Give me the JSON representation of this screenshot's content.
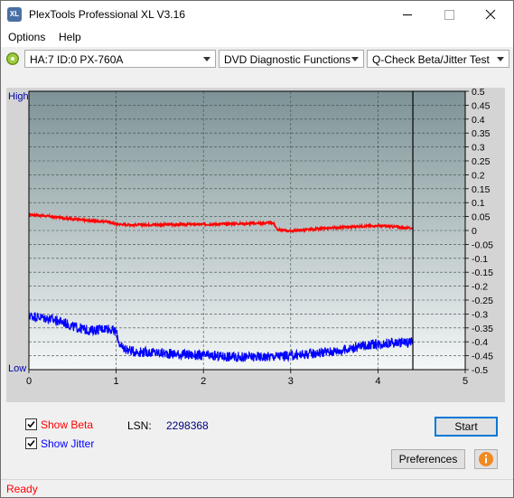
{
  "window": {
    "title": "PlexTools Professional XL V3.16",
    "icon_text": "XL"
  },
  "menu": {
    "options": "Options",
    "help": "Help"
  },
  "toolbar": {
    "drive": "HA:7 ID:0  PX-760A",
    "function": "DVD Diagnostic Functions",
    "test": "Q-Check Beta/Jitter Test"
  },
  "chart_data": {
    "type": "line",
    "left_axis_labels": {
      "high": "High",
      "low": "Low"
    },
    "x_ticks": [
      "0",
      "1",
      "2",
      "3",
      "4",
      "5"
    ],
    "y_ticks": [
      "0.5",
      "0.45",
      "0.4",
      "0.35",
      "0.3",
      "0.25",
      "0.2",
      "0.15",
      "0.1",
      "0.05",
      "0",
      "-0.05",
      "-0.1",
      "-0.15",
      "-0.2",
      "-0.25",
      "-0.3",
      "-0.35",
      "-0.4",
      "-0.45",
      "-0.5"
    ],
    "xlim": [
      0,
      5
    ],
    "ylim": [
      -0.5,
      0.5
    ],
    "grid": true,
    "end_marker_x": 4.4,
    "series": [
      {
        "color": "#ff0000",
        "x": [
          0,
          0.2,
          0.4,
          0.6,
          0.8,
          0.9,
          1.0,
          1.2,
          1.5,
          2.0,
          2.5,
          2.8,
          2.85,
          3.0,
          3.2,
          3.5,
          3.8,
          4.0,
          4.2,
          4.4
        ],
        "y": [
          0.058,
          0.052,
          0.045,
          0.038,
          0.033,
          0.032,
          0.023,
          0.02,
          0.021,
          0.022,
          0.025,
          0.027,
          0.003,
          -0.002,
          0.003,
          0.01,
          0.015,
          0.017,
          0.013,
          0.008
        ]
      },
      {
        "color": "#0000ff",
        "x": [
          0,
          0.2,
          0.4,
          0.5,
          0.7,
          0.9,
          1.0,
          1.05,
          1.2,
          1.5,
          2.0,
          2.5,
          3.0,
          3.3,
          3.6,
          3.9,
          4.1,
          4.4
        ],
        "y": [
          -0.305,
          -0.315,
          -0.33,
          -0.345,
          -0.36,
          -0.35,
          -0.365,
          -0.42,
          -0.435,
          -0.44,
          -0.45,
          -0.455,
          -0.45,
          -0.44,
          -0.43,
          -0.41,
          -0.405,
          -0.4
        ]
      }
    ]
  },
  "options": {
    "show_beta": "Show Beta",
    "show_jitter": "Show Jitter",
    "lsn_label": "LSN:",
    "lsn_value": "2298368"
  },
  "buttons": {
    "start": "Start",
    "preferences": "Preferences"
  },
  "status": {
    "text": "Ready"
  },
  "colors": {
    "beta": "#ff0000",
    "jitter": "#0000ff",
    "plot_top": "#7d9396",
    "plot_bottom": "#f4f7f7"
  }
}
